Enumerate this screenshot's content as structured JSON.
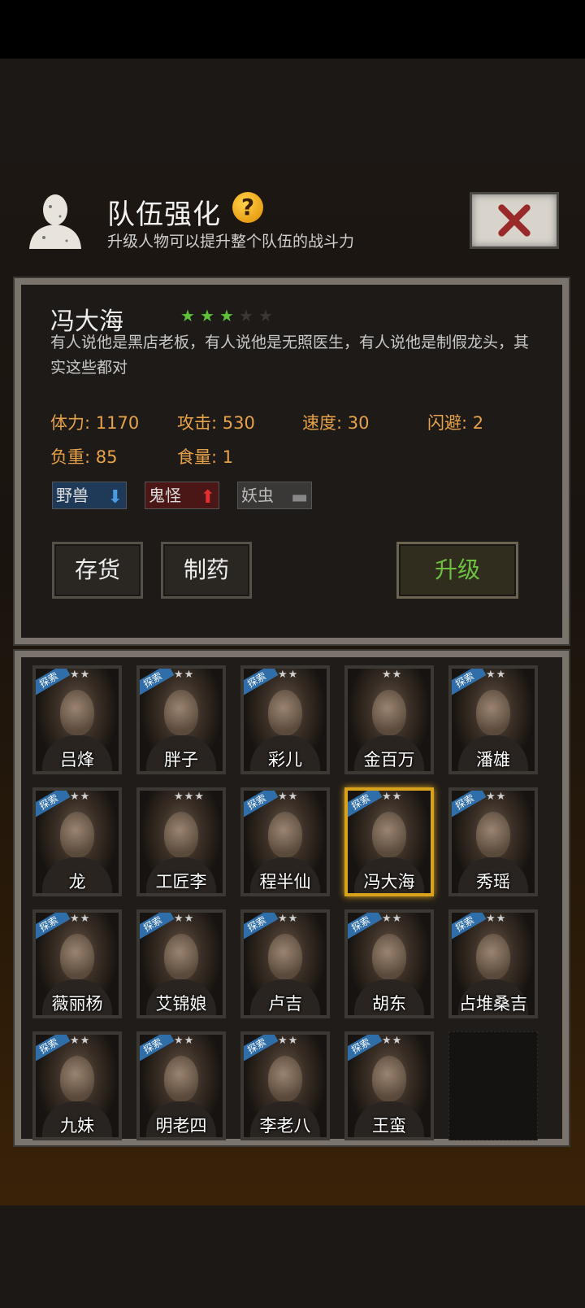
{
  "header": {
    "title": "队伍强化",
    "subtitle": "升级人物可以提升整个队伍的战斗力",
    "help_symbol": "?"
  },
  "hero": {
    "name": "冯大海",
    "stars_total": 5,
    "stars_filled": 3,
    "description": "有人说他是黑店老板，有人说他是无照医生，有人说他是制假龙头，其实这些都对",
    "stats": [
      {
        "label": "体力: 1170"
      },
      {
        "label": "攻击: 530"
      },
      {
        "label": "速度: 30"
      },
      {
        "label": "闪避: 2"
      },
      {
        "label": "负重: 85"
      },
      {
        "label": "食量: 1"
      }
    ],
    "tags": [
      {
        "label": "野兽",
        "trend": "down"
      },
      {
        "label": "鬼怪",
        "trend": "up"
      },
      {
        "label": "妖虫",
        "trend": "neutral"
      }
    ]
  },
  "actions": {
    "store_label": "存货",
    "medicine_label": "制药",
    "upgrade_label": "升级"
  },
  "roster": {
    "badge_label": "探索",
    "characters": [
      {
        "name": "吕烽",
        "stars": "★★",
        "explore": true,
        "selected": false
      },
      {
        "name": "胖子",
        "stars": "★★",
        "explore": true,
        "selected": false
      },
      {
        "name": "彩儿",
        "stars": "★★",
        "explore": true,
        "selected": false
      },
      {
        "name": "金百万",
        "stars": "★★",
        "explore": false,
        "selected": false
      },
      {
        "name": "潘雄",
        "stars": "★★",
        "explore": true,
        "selected": false
      },
      {
        "name": "龙",
        "stars": "★★",
        "explore": true,
        "selected": false
      },
      {
        "name": "工匠李",
        "stars": "★★★",
        "explore": false,
        "selected": false
      },
      {
        "name": "程半仙",
        "stars": "★★",
        "explore": true,
        "selected": false
      },
      {
        "name": "冯大海",
        "stars": "★★",
        "explore": true,
        "selected": true
      },
      {
        "name": "秀瑶",
        "stars": "★★",
        "explore": true,
        "selected": false
      },
      {
        "name": "薇丽杨",
        "stars": "★★",
        "explore": true,
        "selected": false
      },
      {
        "name": "艾锦娘",
        "stars": "★★",
        "explore": true,
        "selected": false
      },
      {
        "name": "卢吉",
        "stars": "★★",
        "explore": true,
        "selected": false
      },
      {
        "name": "胡东",
        "stars": "★★",
        "explore": true,
        "selected": false
      },
      {
        "name": "占堆桑吉",
        "stars": "★★",
        "explore": true,
        "selected": false
      },
      {
        "name": "九妹",
        "stars": "★★",
        "explore": true,
        "selected": false
      },
      {
        "name": "明老四",
        "stars": "★★",
        "explore": true,
        "selected": false
      },
      {
        "name": "李老八",
        "stars": "★★",
        "explore": true,
        "selected": false
      },
      {
        "name": "王蛮",
        "stars": "★★",
        "explore": true,
        "selected": false
      }
    ]
  },
  "colors": {
    "accent_gold": "#d9a21c",
    "stat_orange": "#e6a24a",
    "star_green": "#5fc23a",
    "upgrade_green": "#6cc23e"
  }
}
